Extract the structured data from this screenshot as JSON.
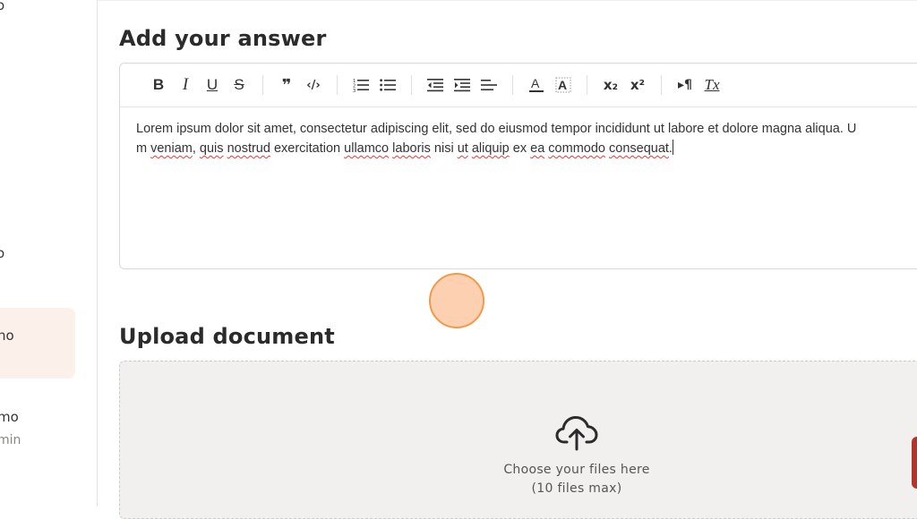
{
  "sidebar": {
    "items": [
      {
        "label": "o"
      },
      {
        "label": "o"
      },
      {
        "label": "no"
      },
      {
        "label": "mo",
        "sub": "min"
      }
    ]
  },
  "answer": {
    "title": "Add your answer",
    "toolbar": {
      "bold": "B",
      "italic": "I",
      "underline": "U",
      "strike": "S",
      "quote": "❞",
      "code": "‹/›",
      "subscript": "x₂",
      "superscript": "x²",
      "rtl": "▸¶",
      "clear": "Tx"
    },
    "content": {
      "line1": "Lorem ipsum dolor sit amet, consectetur adipiscing elit, sed do eiusmod tempor incididunt ut labore et dolore magna aliqua. U",
      "line2_parts": [
        "m ",
        "veniam",
        ", ",
        "quis",
        " ",
        "nostrud",
        " exercitation ",
        "ullamco",
        " ",
        "laboris",
        " nisi ",
        "ut",
        " ",
        "aliquip",
        " ex ",
        "ea",
        " ",
        "commodo",
        " ",
        "consequat",
        "."
      ]
    }
  },
  "upload": {
    "title": "Upload document",
    "hint": "Choose your files here",
    "limit": "(10 files max)"
  },
  "colors": {
    "accent": "#f29a4a",
    "active_bg": "#fcf1ea",
    "upload_bg": "#f1f0ee"
  }
}
